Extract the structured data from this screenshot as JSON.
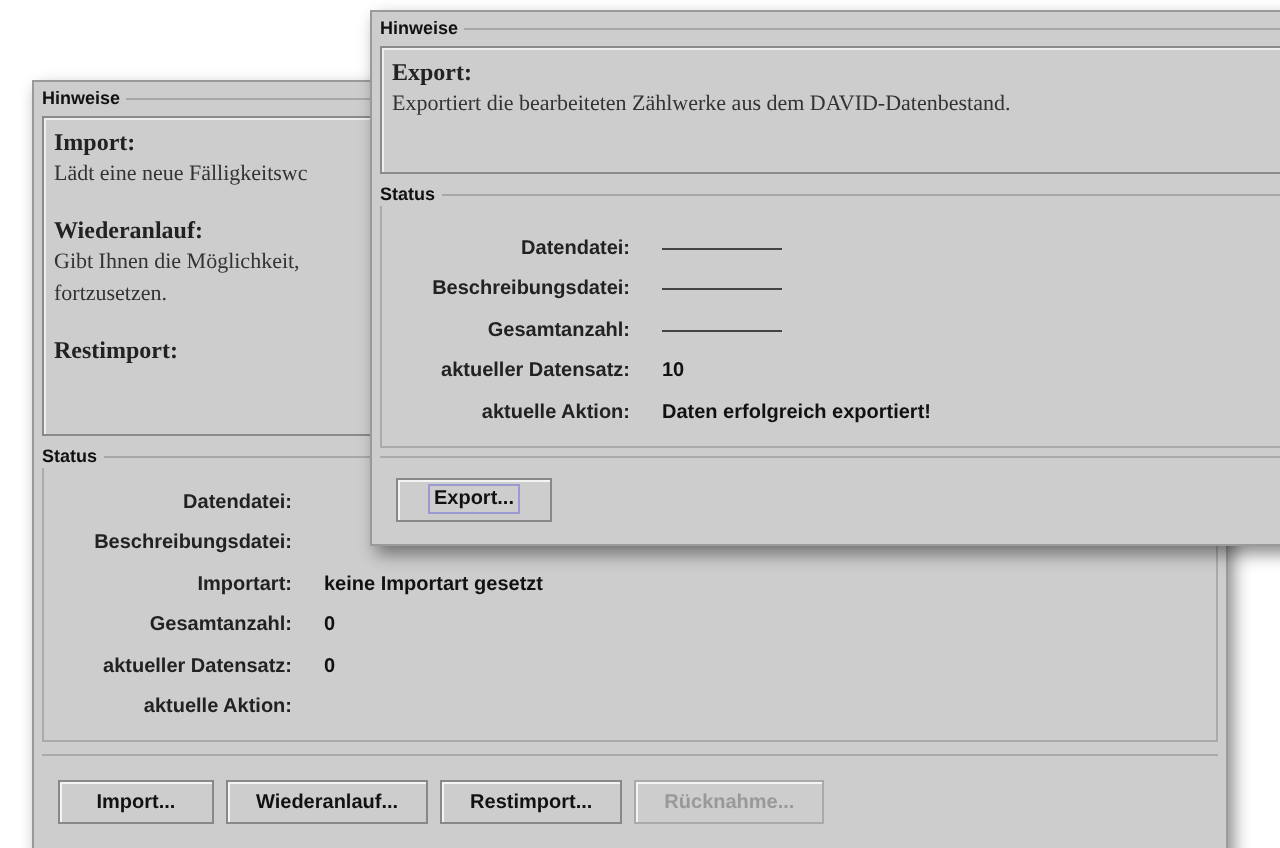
{
  "windows": [
    {
      "hints": {
        "title": "Hinweise",
        "entries": [
          {
            "heading": "Import:",
            "text": [
              "Lädt eine neue Fälligkeitswc"
            ]
          },
          {
            "heading": "Wiederanlauf:",
            "text": [
              "Gibt Ihnen die Möglichkeit,",
              "fortzusetzen."
            ]
          },
          {
            "heading": "Restimport:"
          }
        ]
      },
      "status": {
        "title": "Status",
        "empty_dashes": false,
        "rows": [
          {
            "label": "Datendatei:"
          },
          {
            "label": "Beschreibungsdatei:"
          },
          {
            "label": "Importart:",
            "value": "keine Importart gesetzt"
          },
          {
            "label": "Gesamtanzahl:",
            "value": "0"
          },
          {
            "label": "aktueller Datensatz:",
            "value": "0"
          },
          {
            "label": "aktuelle Aktion:"
          }
        ]
      },
      "buttons": [
        {
          "label": "Import...",
          "disabled": false,
          "focused": false
        },
        {
          "label": "Wiederanlauf...",
          "disabled": false,
          "focused": false
        },
        {
          "label": "Restimport...",
          "disabled": false,
          "focused": false
        },
        {
          "label": "Rücknahme...",
          "disabled": true,
          "focused": false
        }
      ]
    },
    {
      "hints": {
        "title": "Hinweise",
        "entries": [
          {
            "heading": "Export:",
            "text": [
              "Exportiert die bearbeiteten Zählwerke aus dem DAVID-Datenbestand."
            ]
          }
        ]
      },
      "status": {
        "title": "Status",
        "empty_dashes": true,
        "rows": [
          {
            "label": "Datendatei:"
          },
          {
            "label": "Beschreibungsdatei:"
          },
          {
            "label": "Gesamtanzahl:"
          },
          {
            "label": "aktueller Datensatz:",
            "value": "10"
          },
          {
            "label": "aktuelle Aktion:",
            "value": "Daten erfolgreich exportiert!"
          }
        ]
      },
      "buttons": [
        {
          "label": "Export...",
          "disabled": false,
          "focused": true
        }
      ]
    }
  ]
}
